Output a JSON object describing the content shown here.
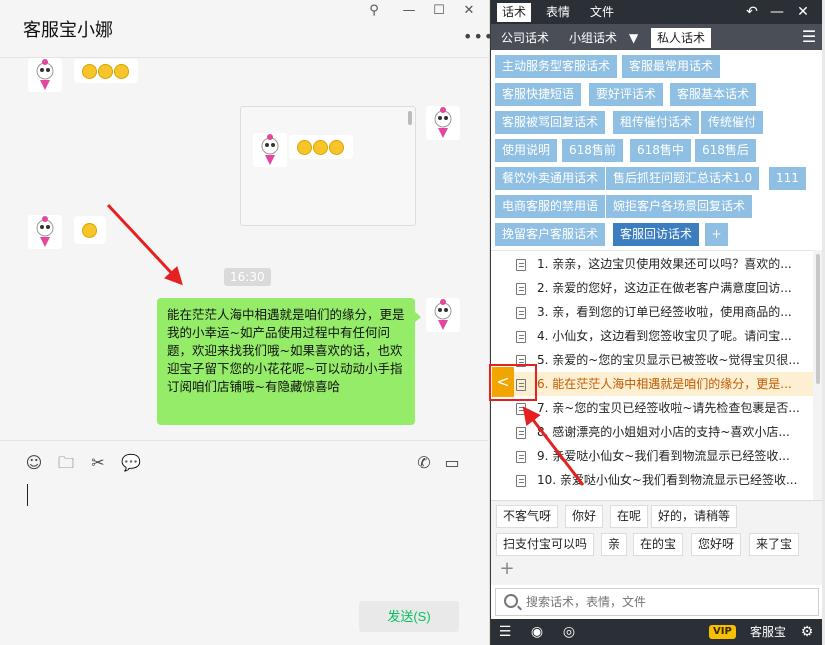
{
  "chat": {
    "title": "客服宝小娜",
    "window_controls": {
      "pin": "pin-icon",
      "minimize": "minimize-icon",
      "maximize": "maximize-icon",
      "close": "close-icon"
    },
    "time_label": "16:30",
    "message_text": "能在茫茫人海中相遇就是咱们的缘分，更是我的小幸运~如产品使用过程中有任何问题，欢迎来找我们哦~如果喜欢的话，也欢迎宝子留下您的小花花呢~可以动动小手指订阅咱们店铺哦~有隐藏惊喜哈",
    "send_button": "发送(S)"
  },
  "panel": {
    "top_tabs": [
      "话术",
      "表情",
      "文件"
    ],
    "sub_tabs": [
      "公司话术",
      "小组话术",
      "私人话术"
    ],
    "sub_dropdown": "▼",
    "categories": [
      "主动服务型客服话术",
      "客服最常用话术",
      "客服快捷短语",
      "要好评话术",
      "客服基本话术",
      "客服被骂回复话术",
      "租传催付话术",
      "传统催付",
      "使用说明",
      "618售前",
      "618售中",
      "618售后",
      "餐饮外卖通用话术",
      "售后抓狂问题汇总话术1.0",
      "111",
      "电商客服的禁用语",
      "婉拒客户各场景回复话术",
      "挽留客户客服话术",
      "客服回访话术"
    ],
    "add_category": "+",
    "scripts": [
      "1. 亲亲，这边宝贝使用效果还可以吗？喜欢的...",
      "2. 亲爱的您好，这边正在做老客户满意度回访...",
      "3. 亲，看到您的订单已经签收啦，使用商品的...",
      "4. 小仙女，这边看到您签收宝贝了呢。请问宝...",
      "5. 亲爱的~您的宝贝显示已被签收~觉得宝贝很...",
      "6. 能在茫茫人海中相遇就是咱们的缘分，更是...",
      "7. 亲~您的宝贝已经签收啦~请先检查包裹是否...",
      "8. 感谢漂亮的小姐姐对小店的支持~喜欢小店...",
      "9. 亲爱哒小仙女~我们看到物流显示已经签收...",
      "10. 亲爱哒小仙女~我们看到物流显示已经签收..."
    ],
    "send_arrow": "<",
    "quick_phrases": [
      "不客气呀",
      "你好",
      "在呢",
      "好的，请稍等",
      "扫支付宝可以吗",
      "亲",
      "在的宝",
      "您好呀",
      "来了宝"
    ],
    "quick_add": "+",
    "search_placeholder": "搜索话术，表情，文件",
    "vip": "VIP",
    "brand": "客服宝"
  },
  "colors": {
    "bubble_green": "#95ec69",
    "category_blue": "#8fbfe3",
    "category_active": "#3c7dbf",
    "highlight": "#fdefd2",
    "annotation_red": "#e62020"
  }
}
